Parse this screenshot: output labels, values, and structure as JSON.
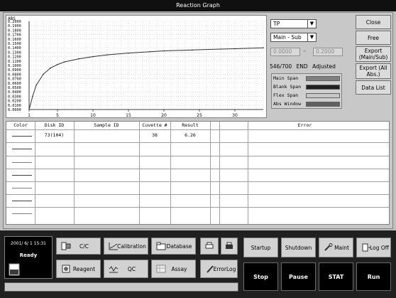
{
  "window": {
    "title": "Reaction Graph"
  },
  "graph": {
    "y_axis_label": "ABS",
    "y_ticks": [
      "0.2000",
      "0.1900",
      "0.1800",
      "0.1700",
      "0.1600",
      "0.1500",
      "0.1400",
      "0.1300",
      "0.1200",
      "0.1100",
      "0.1000",
      "0.0900",
      "0.0800",
      "0.0700",
      "0.0600",
      "0.0500",
      "0.0400",
      "0.0300",
      "0.0200",
      "0.0100",
      "0.0000"
    ],
    "x_ticks": [
      "1",
      "5",
      "10",
      "15",
      "20",
      "25",
      "30"
    ]
  },
  "chart_data": {
    "type": "line",
    "ylabel": "ABS",
    "xlim": [
      1,
      34
    ],
    "ylim": [
      0,
      0.2
    ],
    "x": [
      1,
      1.5,
      2,
      3,
      4,
      5,
      6,
      8,
      10,
      12,
      15,
      18,
      20,
      24,
      28,
      30,
      34
    ],
    "values": [
      0.0,
      0.03,
      0.055,
      0.08,
      0.094,
      0.102,
      0.108,
      0.115,
      0.12,
      0.124,
      0.128,
      0.131,
      0.133,
      0.135,
      0.137,
      0.138,
      0.14
    ],
    "grid": true
  },
  "controls": {
    "test_select": "TP",
    "wave_select": "Main - Sub",
    "range_from": "0.0000",
    "range_dash": "–",
    "range_to": "0.2000",
    "status_count": "546/700",
    "status_end": "END",
    "status_adjusted": "Adjusted"
  },
  "legend": [
    {
      "label": "Main Span",
      "color": "#808080"
    },
    {
      "label": "Blank Span",
      "color": "#202020"
    },
    {
      "label": "Flex Span",
      "color": "#c8c8c8"
    },
    {
      "label": "Abs Window",
      "color": "#606060"
    }
  ],
  "side_buttons": {
    "close": "Close",
    "free": "Free",
    "export_main_sub": "Export (Main/Sub)",
    "export_all": "Export (All Abs.)",
    "data_list": "Data List"
  },
  "table": {
    "headers": [
      "Color",
      "Disk ID",
      "Sample ID",
      "Cuvette #",
      "Result",
      "Error"
    ],
    "rows": [
      {
        "disk_id": "73(104)",
        "sample_id": "",
        "cuvette": "38",
        "result": "6.26",
        "error": ""
      }
    ]
  },
  "status": {
    "datetime": "2001/ 6/ 1 15:31",
    "state": "Ready"
  },
  "menu": {
    "cc": "C/C",
    "calibration": "Calibration",
    "database": "Database",
    "reagent": "Reagent",
    "qc": "QC",
    "assay": "Assay",
    "errorlog": "ErrorLog",
    "startup": "Startup",
    "shutdown": "Shutdown",
    "maint": "Maint",
    "logoff": "Log Off",
    "stop": "Stop",
    "pause": "Pause",
    "stat": "STAT",
    "run": "Run"
  }
}
